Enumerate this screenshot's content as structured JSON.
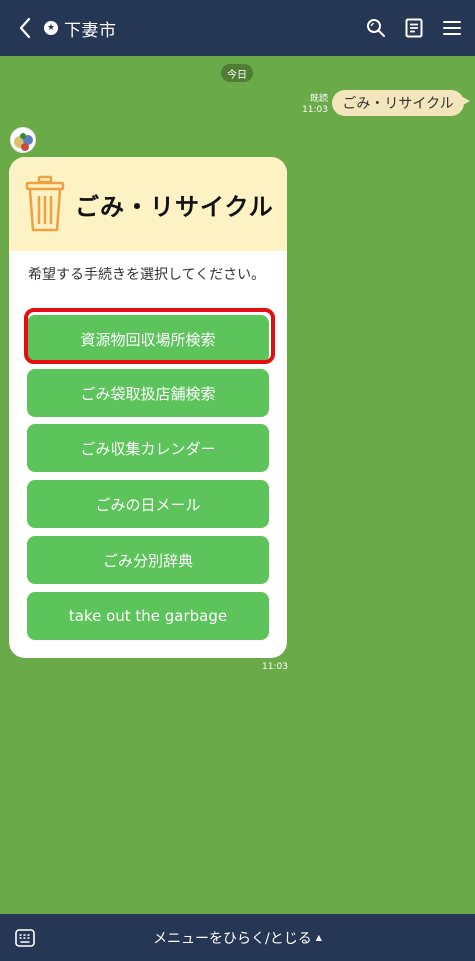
{
  "header": {
    "title": "下妻市",
    "icons": {
      "back": "chevron-left-icon",
      "search": "search-icon",
      "notes": "notes-icon",
      "menu": "hamburger-menu-icon"
    }
  },
  "chat": {
    "date_label": "今日",
    "user_message": {
      "text": "ごみ・リサイクル",
      "read_label": "既読",
      "time": "11:03"
    },
    "bot_card": {
      "title": "ごみ・リサイクル",
      "description": "希望する手続きを選択してください。",
      "options": [
        {
          "label": "資源物回収場所検索"
        },
        {
          "label": "ごみ袋取扱店舗検索"
        },
        {
          "label": "ごみ収集カレンダー"
        },
        {
          "label": "ごみの日メール"
        },
        {
          "label": "ごみ分別辞典"
        },
        {
          "label": "take out the garbage"
        }
      ],
      "time": "11:03"
    }
  },
  "bottom_bar": {
    "menu_label": "メニューをひらく/とじる",
    "caret": "▲"
  },
  "colors": {
    "header_bg": "#263655",
    "chat_bg": "#6aaa48",
    "button_green": "#5cc45b",
    "card_header_bg": "#fdf2c4",
    "user_bubble": "#f4e6bc",
    "highlight_red": "#e40d11"
  }
}
